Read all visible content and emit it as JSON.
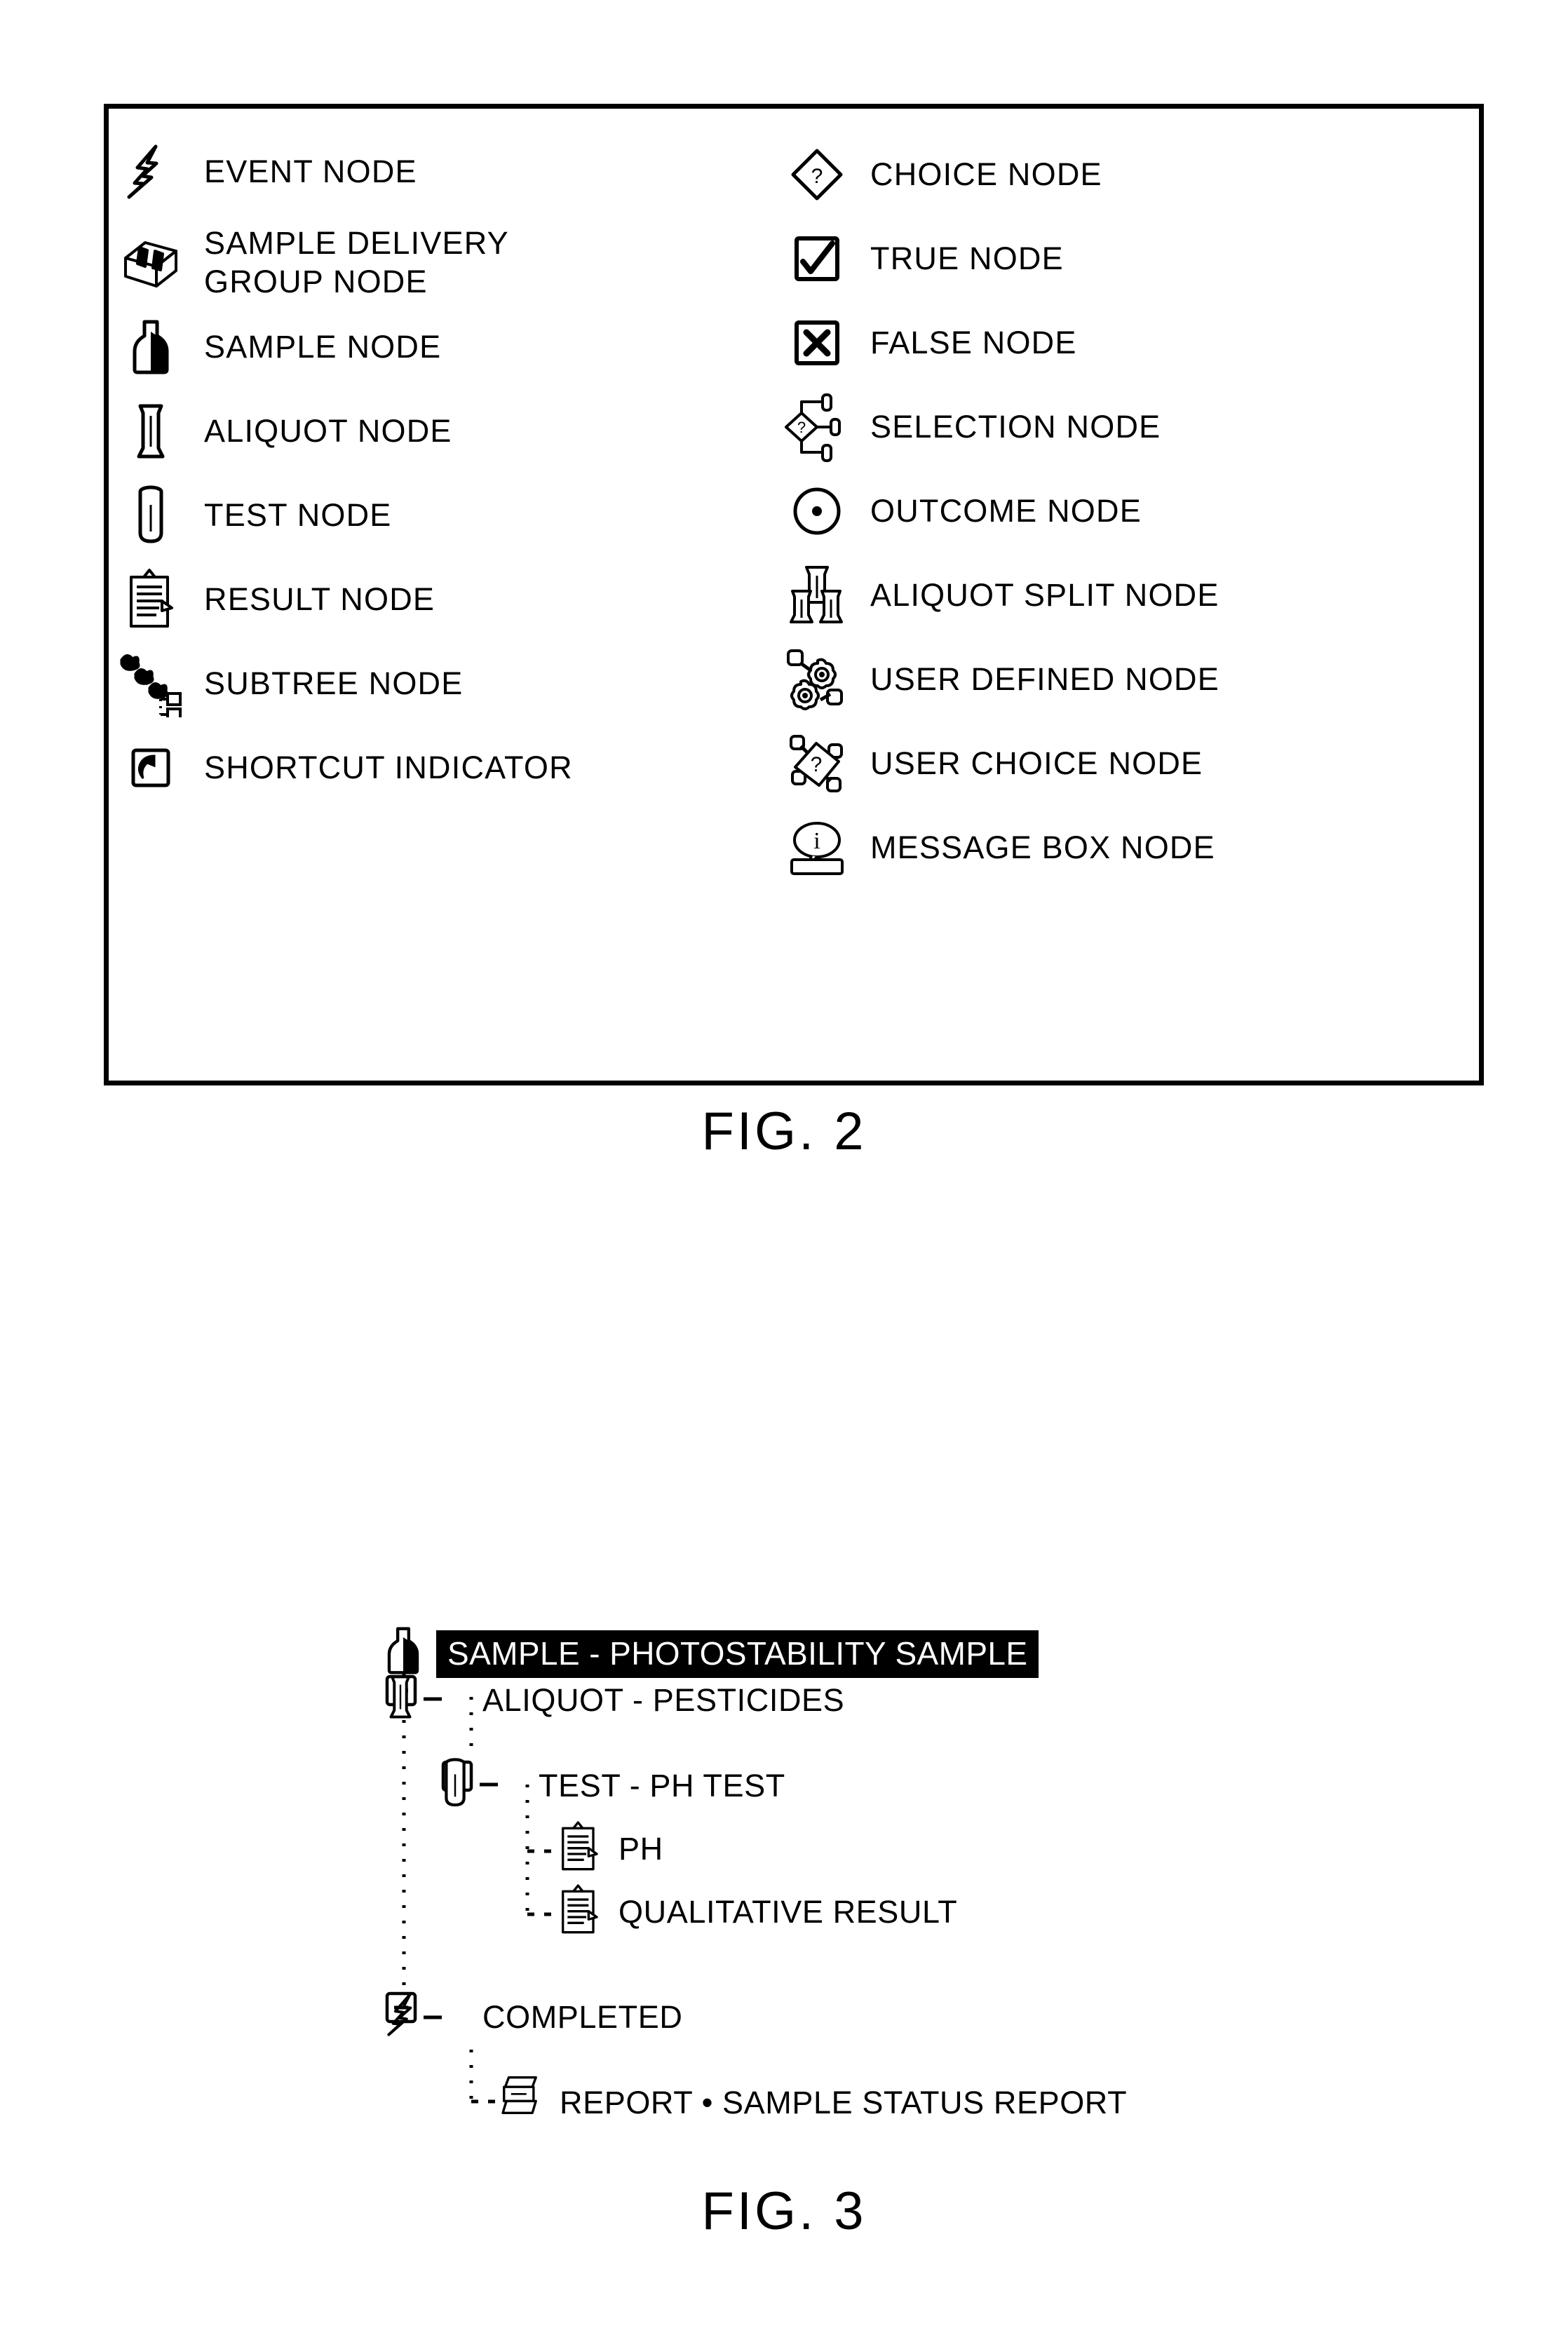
{
  "figures": {
    "fig2": {
      "caption": "FIG. 2",
      "legend_left": [
        {
          "icon": "event-node-icon",
          "label": "EVENT NODE"
        },
        {
          "icon": "sample-delivery-group-node-icon",
          "label": "SAMPLE DELIVERY\nGROUP NODE"
        },
        {
          "icon": "sample-node-icon",
          "label": "SAMPLE NODE"
        },
        {
          "icon": "aliquot-node-icon",
          "label": "ALIQUOT NODE"
        },
        {
          "icon": "test-node-icon",
          "label": "TEST NODE"
        },
        {
          "icon": "result-node-icon",
          "label": "RESULT NODE"
        },
        {
          "icon": "subtree-node-icon",
          "label": "SUBTREE NODE"
        },
        {
          "icon": "shortcut-indicator-icon",
          "label": "SHORTCUT INDICATOR"
        }
      ],
      "legend_right": [
        {
          "icon": "choice-node-icon",
          "label": "CHOICE NODE"
        },
        {
          "icon": "true-node-icon",
          "label": "TRUE NODE"
        },
        {
          "icon": "false-node-icon",
          "label": "FALSE NODE"
        },
        {
          "icon": "selection-node-icon",
          "label": "SELECTION NODE"
        },
        {
          "icon": "outcome-node-icon",
          "label": "OUTCOME NODE"
        },
        {
          "icon": "aliquot-split-node-icon",
          "label": "ALIQUOT SPLIT NODE"
        },
        {
          "icon": "user-defined-node-icon",
          "label": "USER DEFINED NODE"
        },
        {
          "icon": "user-choice-node-icon",
          "label": "USER CHOICE NODE"
        },
        {
          "icon": "message-box-node-icon",
          "label": "MESSAGE BOX NODE"
        }
      ]
    },
    "fig3": {
      "caption": "FIG. 3",
      "tree_rows": [
        {
          "label": "SAMPLE - PHOTOSTABILITY SAMPLE",
          "icon": "sample-node-icon",
          "expander": "minus",
          "selected": true
        },
        {
          "label": "ALIQUOT - PESTICIDES",
          "icon": "aliquot-node-icon",
          "expander": "minus",
          "selected": false
        },
        {
          "label": "TEST - PH TEST",
          "icon": "test-node-icon",
          "expander": "minus",
          "selected": false
        },
        {
          "label": "PH",
          "icon": "result-node-icon",
          "expander": "none",
          "selected": false
        },
        {
          "label": "QUALITATIVE RESULT",
          "icon": "result-node-icon",
          "expander": "none",
          "selected": false
        },
        {
          "label": "COMPLETED",
          "icon": "event-node-icon",
          "expander": "minus",
          "selected": false
        },
        {
          "label": "REPORT • SAMPLE STATUS REPORT",
          "icon": "report-node-icon",
          "expander": "none",
          "selected": false
        }
      ]
    }
  },
  "colors": {
    "ink": "#000000",
    "paper": "#ffffff",
    "selection_bg": "#000000",
    "selection_fg": "#ffffff"
  }
}
